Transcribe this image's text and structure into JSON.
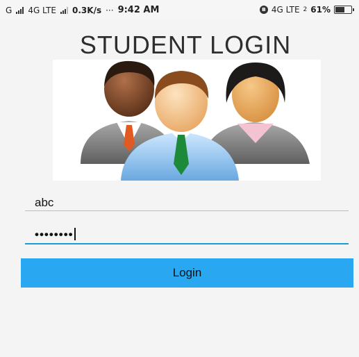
{
  "status_bar": {
    "carrier1": "G",
    "carrier2": "4G LTE",
    "speed": "0.3K/s",
    "dots": "···",
    "time": "9:42 AM",
    "network_right": "4G LTE",
    "network_right_sub": "2",
    "battery_percent": "61%",
    "battery_level": 0.61,
    "icons": [
      "signal-icon",
      "bluetooth-icon",
      "battery-icon"
    ]
  },
  "page": {
    "title": "STUDENT LOGIN",
    "hero_image": "students-group-icon"
  },
  "form": {
    "username_value": "abc",
    "password_value": "••••••••",
    "login_label": "Login"
  },
  "colors": {
    "accent": "#29a7f0",
    "focus_underline": "#1b9bd6",
    "background": "#f4f4f4"
  }
}
